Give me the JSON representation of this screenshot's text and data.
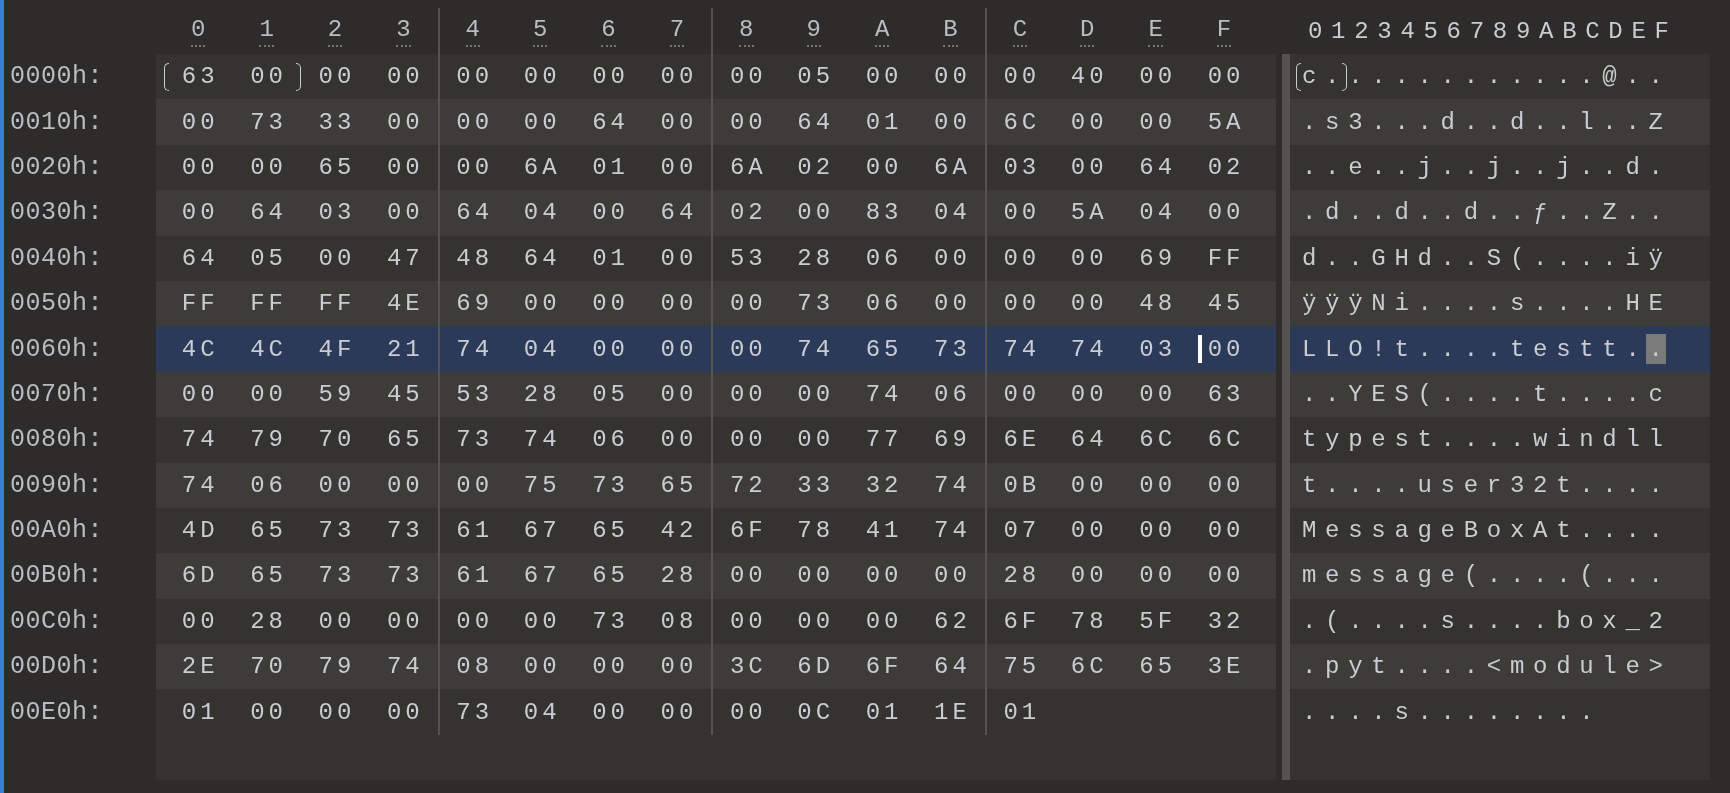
{
  "columns": [
    "0",
    "1",
    "2",
    "3",
    "4",
    "5",
    "6",
    "7",
    "8",
    "9",
    "A",
    "B",
    "C",
    "D",
    "E",
    "F"
  ],
  "ascii_header": "0123456789ABCDEF",
  "rows": [
    {
      "offset": "0000h:",
      "bytes": [
        "63",
        "00",
        "00",
        "00",
        "00",
        "00",
        "00",
        "00",
        "00",
        "05",
        "00",
        "00",
        "00",
        "40",
        "00",
        "00"
      ],
      "ascii": "c............@..",
      "selected": false,
      "bracketed": true,
      "cursor": false
    },
    {
      "offset": "0010h:",
      "bytes": [
        "00",
        "73",
        "33",
        "00",
        "00",
        "00",
        "64",
        "00",
        "00",
        "64",
        "01",
        "00",
        "6C",
        "00",
        "00",
        "5A"
      ],
      "ascii": ".s3...d..d..l..Z",
      "selected": false
    },
    {
      "offset": "0020h:",
      "bytes": [
        "00",
        "00",
        "65",
        "00",
        "00",
        "6A",
        "01",
        "00",
        "6A",
        "02",
        "00",
        "6A",
        "03",
        "00",
        "64",
        "02"
      ],
      "ascii": "..e..j..j..j..d.",
      "selected": false
    },
    {
      "offset": "0030h:",
      "bytes": [
        "00",
        "64",
        "03",
        "00",
        "64",
        "04",
        "00",
        "64",
        "02",
        "00",
        "83",
        "04",
        "00",
        "5A",
        "04",
        "00"
      ],
      "ascii": ".d..d..d..ƒ..Z..",
      "selected": false
    },
    {
      "offset": "0040h:",
      "bytes": [
        "64",
        "05",
        "00",
        "47",
        "48",
        "64",
        "01",
        "00",
        "53",
        "28",
        "06",
        "00",
        "00",
        "00",
        "69",
        "FF"
      ],
      "ascii": "d..GHd..S(....iÿ",
      "selected": false
    },
    {
      "offset": "0050h:",
      "bytes": [
        "FF",
        "FF",
        "FF",
        "4E",
        "69",
        "00",
        "00",
        "00",
        "00",
        "73",
        "06",
        "00",
        "00",
        "00",
        "48",
        "45"
      ],
      "ascii": "ÿÿÿNi....s....HE",
      "selected": false
    },
    {
      "offset": "0060h:",
      "bytes": [
        "4C",
        "4C",
        "4F",
        "21",
        "74",
        "04",
        "00",
        "00",
        "00",
        "74",
        "65",
        "73",
        "74",
        "74",
        "03",
        "00"
      ],
      "ascii": "LLO!t....testt..",
      "selected": true,
      "bracketed": false,
      "cursor": true
    },
    {
      "offset": "0070h:",
      "bytes": [
        "00",
        "00",
        "59",
        "45",
        "53",
        "28",
        "05",
        "00",
        "00",
        "00",
        "74",
        "06",
        "00",
        "00",
        "00",
        "63"
      ],
      "ascii": "..YES(....t....c",
      "selected": false
    },
    {
      "offset": "0080h:",
      "bytes": [
        "74",
        "79",
        "70",
        "65",
        "73",
        "74",
        "06",
        "00",
        "00",
        "00",
        "77",
        "69",
        "6E",
        "64",
        "6C",
        "6C"
      ],
      "ascii": "typest....windll",
      "selected": false
    },
    {
      "offset": "0090h:",
      "bytes": [
        "74",
        "06",
        "00",
        "00",
        "00",
        "75",
        "73",
        "65",
        "72",
        "33",
        "32",
        "74",
        "0B",
        "00",
        "00",
        "00"
      ],
      "ascii": "t....user32t....",
      "selected": false
    },
    {
      "offset": "00A0h:",
      "bytes": [
        "4D",
        "65",
        "73",
        "73",
        "61",
        "67",
        "65",
        "42",
        "6F",
        "78",
        "41",
        "74",
        "07",
        "00",
        "00",
        "00"
      ],
      "ascii": "MessageBoxAt....",
      "selected": false
    },
    {
      "offset": "00B0h:",
      "bytes": [
        "6D",
        "65",
        "73",
        "73",
        "61",
        "67",
        "65",
        "28",
        "00",
        "00",
        "00",
        "00",
        "28",
        "00",
        "00",
        "00"
      ],
      "ascii": "message(....(...",
      "selected": false
    },
    {
      "offset": "00C0h:",
      "bytes": [
        "00",
        "28",
        "00",
        "00",
        "00",
        "00",
        "73",
        "08",
        "00",
        "00",
        "00",
        "62",
        "6F",
        "78",
        "5F",
        "32"
      ],
      "ascii": ".(....s....box_2",
      "selected": false
    },
    {
      "offset": "00D0h:",
      "bytes": [
        "2E",
        "70",
        "79",
        "74",
        "08",
        "00",
        "00",
        "00",
        "3C",
        "6D",
        "6F",
        "64",
        "75",
        "6C",
        "65",
        "3E"
      ],
      "ascii": ".pyt....<module>",
      "selected": false
    },
    {
      "offset": "00E0h:",
      "bytes": [
        "01",
        "00",
        "00",
        "00",
        "73",
        "04",
        "00",
        "00",
        "00",
        "0C",
        "01",
        "1E",
        "01"
      ],
      "ascii": "....s........",
      "selected": false
    }
  ]
}
